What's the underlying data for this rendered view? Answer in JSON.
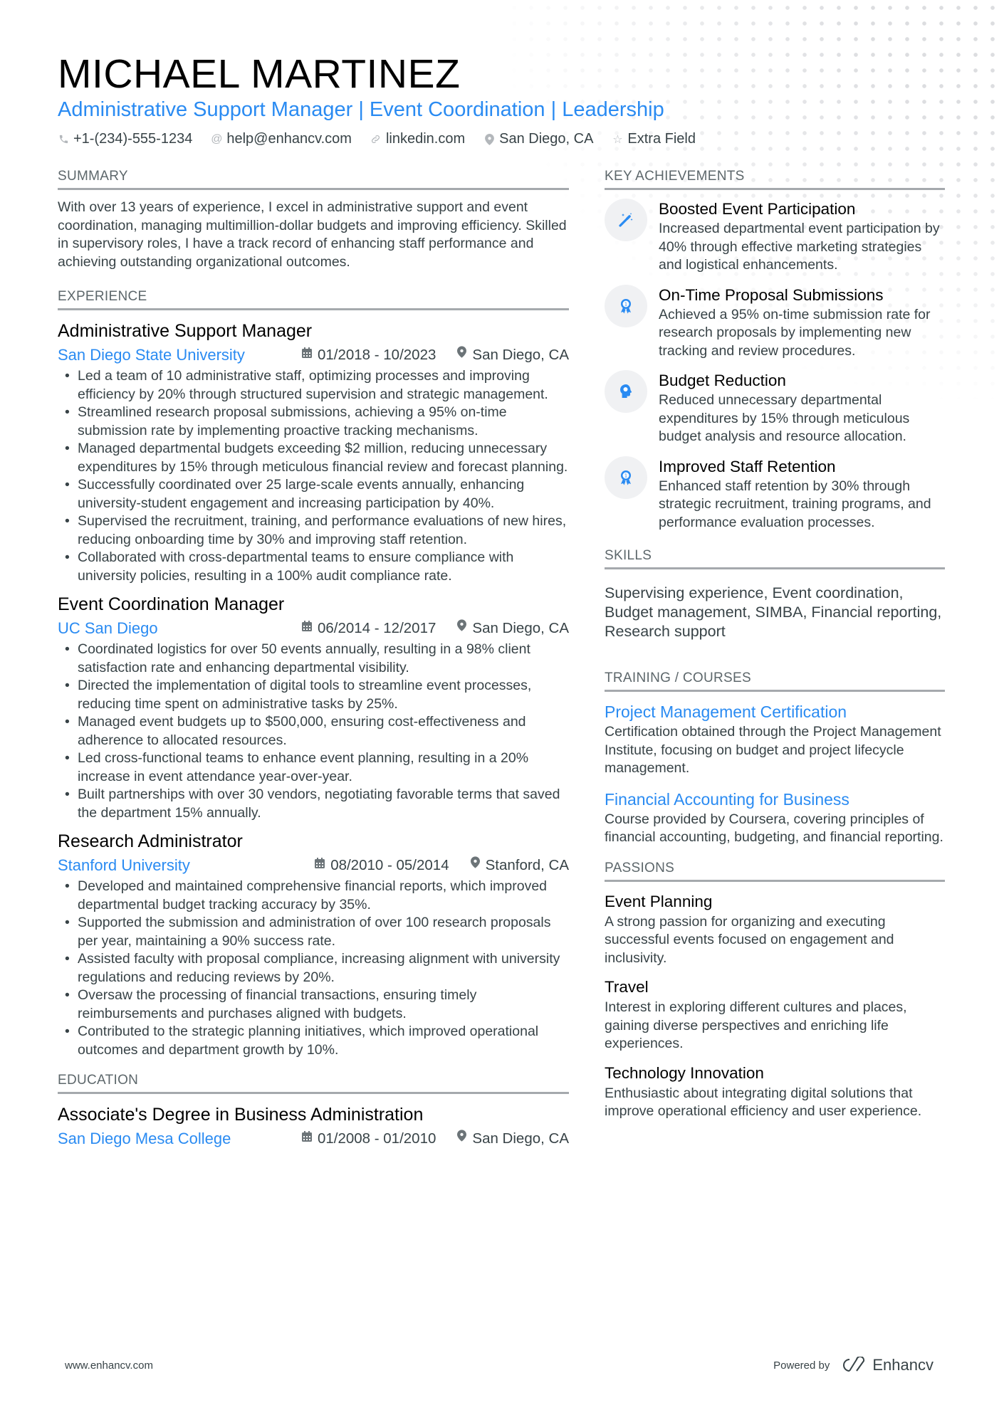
{
  "header": {
    "name": "MICHAEL MARTINEZ",
    "headline": "Administrative Support Manager | Event Coordination | Leadership",
    "contacts": [
      {
        "icon": "phone-icon",
        "text": "+1-(234)-555-1234"
      },
      {
        "icon": "at-icon",
        "text": "help@enhancv.com"
      },
      {
        "icon": "link-icon",
        "text": "linkedin.com"
      },
      {
        "icon": "location-icon",
        "text": "San Diego, CA"
      },
      {
        "icon": "star-icon",
        "text": "Extra Field"
      }
    ]
  },
  "summary": {
    "title": "SUMMARY",
    "text": "With over 13 years of experience, I excel in administrative support and event coordination, managing multimillion-dollar budgets and improving efficiency. Skilled in supervisory roles, I have a track record of enhancing staff performance and achieving outstanding organizational outcomes."
  },
  "experience": {
    "title": "EXPERIENCE",
    "jobs": [
      {
        "title": "Administrative Support Manager",
        "company": "San Diego State University",
        "dates": "01/2018 - 10/2023",
        "location": "San Diego, CA",
        "bullets": [
          "Led a team of 10 administrative staff, optimizing processes and improving efficiency by 20% through structured supervision and strategic management.",
          "Streamlined research proposal submissions, achieving a 95% on-time submission rate by implementing proactive tracking mechanisms.",
          "Managed departmental budgets exceeding $2 million, reducing unnecessary expenditures by 15% through meticulous financial review and forecast planning.",
          "Successfully coordinated over 25 large-scale events annually, enhancing university-student engagement and increasing participation by 40%.",
          "Supervised the recruitment, training, and performance evaluations of new hires, reducing onboarding time by 30% and improving staff retention.",
          "Collaborated with cross-departmental teams to ensure compliance with university policies, resulting in a 100% audit compliance rate."
        ]
      },
      {
        "title": "Event Coordination Manager",
        "company": "UC San Diego",
        "dates": "06/2014 - 12/2017",
        "location": "San Diego, CA",
        "bullets": [
          "Coordinated logistics for over 50 events annually, resulting in a 98% client satisfaction rate and enhancing departmental visibility.",
          "Directed the implementation of digital tools to streamline event processes, reducing time spent on administrative tasks by 25%.",
          "Managed event budgets up to $500,000, ensuring cost-effectiveness and adherence to allocated resources.",
          "Led cross-functional teams to enhance event planning, resulting in a 20% increase in event attendance year-over-year.",
          "Built partnerships with over 30 vendors, negotiating favorable terms that saved the department 15% annually."
        ]
      },
      {
        "title": "Research Administrator",
        "company": "Stanford University",
        "dates": "08/2010 - 05/2014",
        "location": "Stanford, CA",
        "bullets": [
          "Developed and maintained comprehensive financial reports, which improved departmental budget tracking accuracy by 35%.",
          "Supported the submission and administration of over 100 research proposals per year, maintaining a 90% success rate.",
          "Assisted faculty with proposal compliance, increasing alignment with university regulations and reducing reviews by 20%.",
          "Oversaw the processing of financial transactions, ensuring timely reimbursements and purchases aligned with budgets.",
          "Contributed to the strategic planning initiatives, which improved operational outcomes and department growth by 10%."
        ]
      }
    ]
  },
  "education": {
    "title": "EDUCATION",
    "items": [
      {
        "degree": "Associate's Degree in Business Administration",
        "school": "San Diego Mesa College",
        "dates": "01/2008 - 01/2010",
        "location": "San Diego, CA"
      }
    ]
  },
  "achievements": {
    "title": "KEY ACHIEVEMENTS",
    "items": [
      {
        "icon": "magic-wand-icon",
        "title": "Boosted Event Participation",
        "desc": "Increased departmental event participation by 40% through effective marketing strategies and logistical enhancements."
      },
      {
        "icon": "award-ribbon-icon",
        "title": "On-Time Proposal Submissions",
        "desc": "Achieved a 95% on-time submission rate for research proposals by implementing new tracking and review procedures."
      },
      {
        "icon": "head-idea-icon",
        "title": "Budget Reduction",
        "desc": "Reduced unnecessary departmental expenditures by 15% through meticulous budget analysis and resource allocation."
      },
      {
        "icon": "award-ribbon-icon",
        "title": "Improved Staff Retention",
        "desc": "Enhanced staff retention by 30% through strategic recruitment, training programs, and performance evaluation processes."
      }
    ]
  },
  "skills": {
    "title": "SKILLS",
    "text": "Supervising experience, Event coordination, Budget management, SIMBA, Financial reporting, Research support"
  },
  "training": {
    "title": "TRAINING / COURSES",
    "items": [
      {
        "title": "Project Management Certification",
        "desc": "Certification obtained through the Project Management Institute, focusing on budget and project lifecycle management."
      },
      {
        "title": "Financial Accounting for Business",
        "desc": "Course provided by Coursera, covering principles of financial accounting, budgeting, and financial reporting."
      }
    ]
  },
  "passions": {
    "title": "PASSIONS",
    "items": [
      {
        "title": "Event Planning",
        "desc": "A strong passion for organizing and executing successful events focused on engagement and inclusivity."
      },
      {
        "title": "Travel",
        "desc": "Interest in exploring different cultures and places, gaining diverse perspectives and enriching life experiences."
      },
      {
        "title": "Technology Innovation",
        "desc": "Enthusiastic about integrating digital solutions that improve operational efficiency and user experience."
      }
    ]
  },
  "footer": {
    "url": "www.enhancv.com",
    "powered_by": "Powered by",
    "brand": "Enhancv"
  },
  "colors": {
    "accent": "#2a8bf2",
    "text": "#384347",
    "heading": "#000000",
    "rule": "#a5a9ad",
    "icon_bg": "#f0f1f3"
  }
}
